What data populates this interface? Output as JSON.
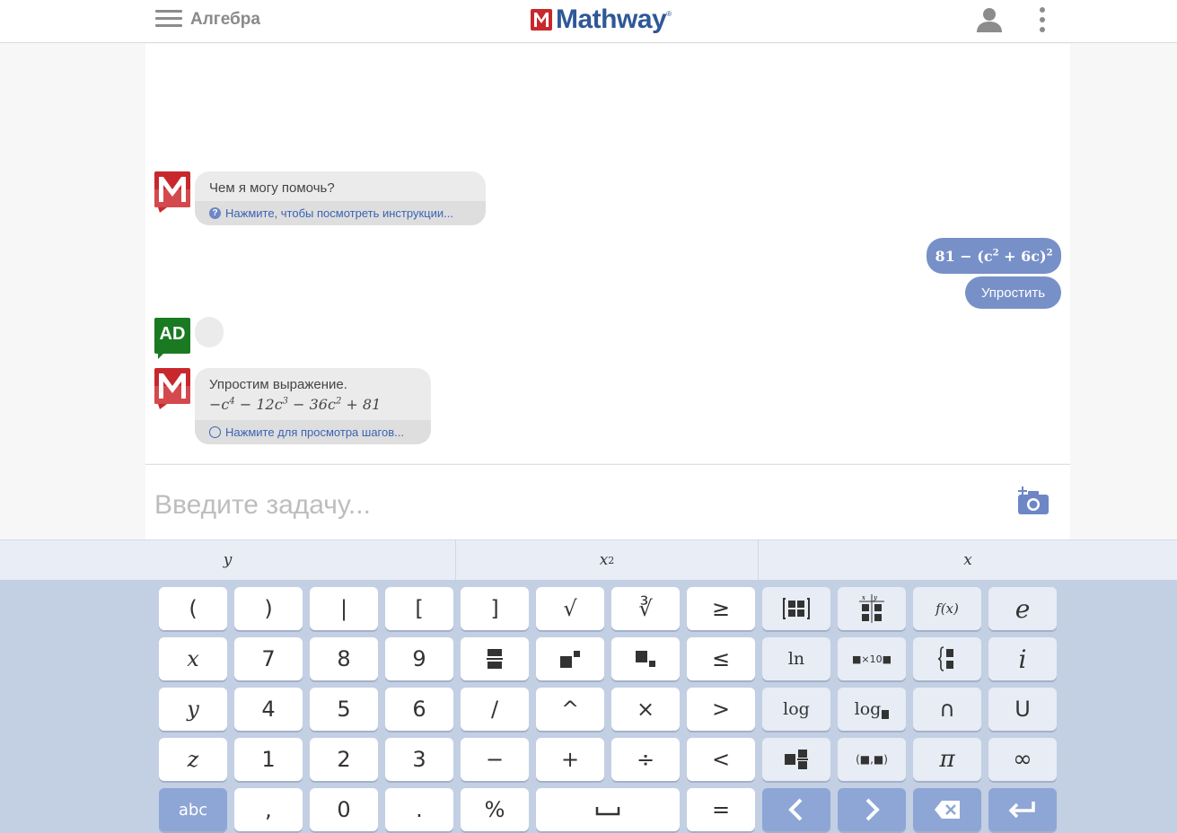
{
  "header": {
    "subject": "Алгебра",
    "logo_text": "Mathway",
    "logo_tm": "®"
  },
  "chat": {
    "greeting": {
      "text": "Чем я могу помочь?",
      "link": "Нажмите, чтобы посмотреть инструкции..."
    },
    "user_problem": {
      "expression_base": "81 − (c",
      "sq": "2",
      "expression_mid": " + 6c)",
      "outer_sq": "2",
      "action": "Упростить"
    },
    "ad_label": "AD",
    "answer": {
      "text": "Упростим выражение.",
      "math_parts": [
        "−c",
        "4",
        " − 12c",
        "3",
        " − 36c",
        "2",
        " + 81"
      ],
      "link": "Нажмите для просмотра шагов..."
    }
  },
  "input": {
    "placeholder": "Введите задачу..."
  },
  "suggestions": [
    "y",
    "x²",
    "x"
  ],
  "keys": {
    "row1": [
      "(",
      ")",
      "|",
      "[",
      "]",
      "√",
      "∛",
      "≥",
      "matrix",
      "table",
      "f(x)",
      "e"
    ],
    "row2": [
      "x",
      "7",
      "8",
      "9",
      "frac",
      "pow",
      "sub",
      "≤",
      "ln",
      "■×10■",
      "{",
      "i"
    ],
    "row3": [
      "y",
      "4",
      "5",
      "6",
      "/",
      "^",
      "×",
      ">",
      "log",
      "log",
      "∩",
      "U"
    ],
    "row4": [
      "z",
      "1",
      "2",
      "3",
      "−",
      "+",
      "÷",
      "<",
      "mixed",
      "(■,■)",
      "π",
      "∞"
    ],
    "row5": [
      "abc",
      ",",
      "0",
      ".",
      "%",
      "space",
      "=",
      "left",
      "right",
      "backspace",
      "enter"
    ]
  },
  "colors": {
    "brand_red": "#c8282d",
    "brand_blue": "#2f5897",
    "bubble_blue": "#7890c8",
    "keyboard_bg": "#c3cfe3",
    "ad_green": "#1a7a22"
  }
}
